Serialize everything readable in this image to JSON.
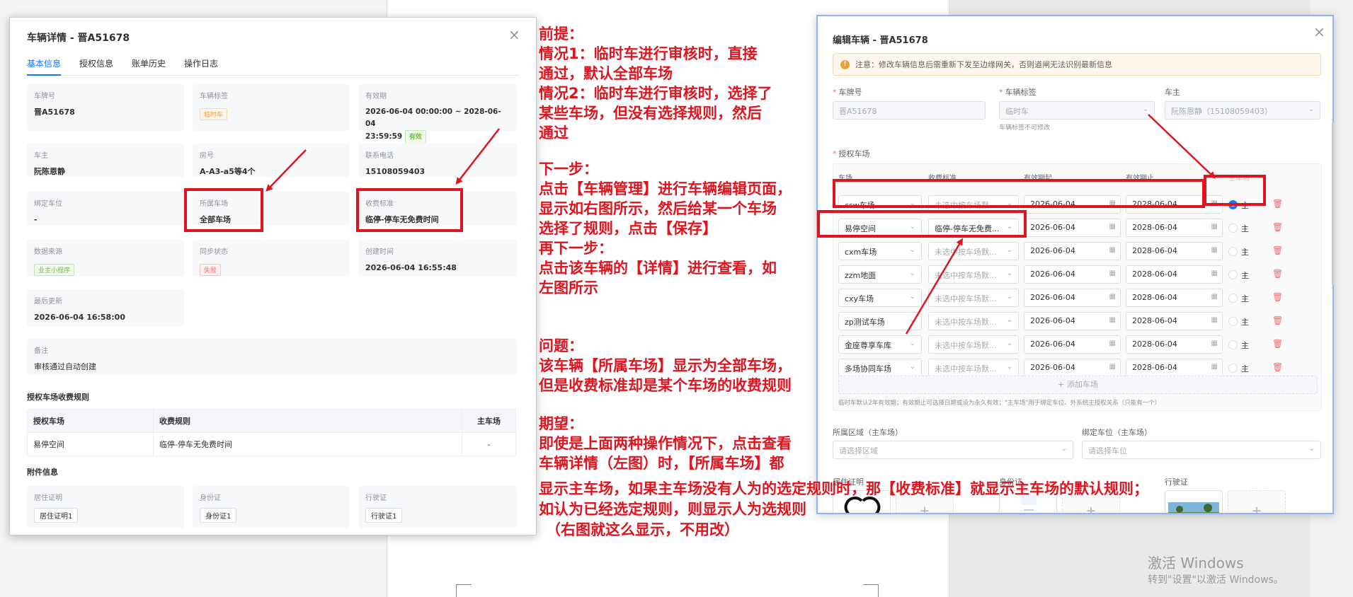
{
  "left_dialog": {
    "title": "车辆详情 - 晋A51678",
    "tabs": [
      "基本信息",
      "授权信息",
      "账单历史",
      "操作日志"
    ],
    "fields": {
      "plate_label": "车牌号",
      "plate_value": "晋A51678",
      "tag_label": "车辆标签",
      "tag_value": "临时车",
      "validity_label": "有效期",
      "validity_value": "2026-06-04 00:00:00 ~ 2028-06-04",
      "validity_value2": "23:59:59",
      "validity_badge": "有效",
      "owner_label": "车主",
      "owner_value": "阮陈恩静",
      "room_label": "房号",
      "room_value": "A-A3-a5等4个",
      "phone_label": "联系电话",
      "phone_value": "15108059403",
      "slot_label": "绑定车位",
      "slot_value": "-",
      "lot_label": "所属车场",
      "lot_value": "全部车场",
      "fee_label": "收费标准",
      "fee_value": "临停-停车无免费时间",
      "source_label": "数据来源",
      "source_value": "业主小程序",
      "sync_label": "同步状态",
      "sync_value": "失败",
      "created_label": "创建时间",
      "created_value": "2026-06-04 16:55:48",
      "updated_label": "最后更新",
      "updated_value": "2026-06-04 16:58:00",
      "remark_label": "备注",
      "remark_value": "审核通过自动创建"
    },
    "rules_section_title": "授权车场收费规则",
    "rules_table": {
      "headers": [
        "授权车场",
        "收费规则",
        "主车场"
      ],
      "rows": [
        [
          "易停空间",
          "临停-停车无免费时间",
          "-"
        ]
      ]
    },
    "attachments_title": "附件信息",
    "attachments": [
      {
        "label": "居住证明",
        "value": "居住证明1"
      },
      {
        "label": "身份证",
        "value": "身份证1"
      },
      {
        "label": "行驶证",
        "value": "行驶证1"
      }
    ]
  },
  "annotation": {
    "lines": [
      "前提：",
      "情况1：临时车进行审核时，直接",
      "通过，默认全部车场",
      "情况2：临时车进行审核时，选择了",
      "某些车场，但没有选择规则，然后",
      "通过",
      "",
      "下一步：",
      "点击【车辆管理】进行车辆编辑页面，",
      "显示如右图所示，然后给某一个车场",
      "选择了规则，点击【保存】",
      "再下一步：",
      "点击该车辆的【详情】进行查看，如",
      "左图所示",
      "",
      "",
      "问题：",
      "该车辆【所属车场】显示为全部车场，",
      "但是收费标准却是某个车场的收费规则",
      "",
      "期望：",
      "即使是上面两种操作情况下，点击查看",
      "车辆详情（左图）时，【所属车场】都"
    ],
    "bottom_lines": [
      "显示主车场，如果主车场没有人为的选定规则时，那【收费标准】就显示主车场的默认规则；",
      "如认为已经选定规则，则显示人为选规则",
      "（右图就这么显示，不用改）"
    ]
  },
  "right_dialog": {
    "title": "编辑车辆 - 晋A51678",
    "alert": "注意：修改车辆信息后需重新下发至边缘网关，否则道闸无法识别最新信息",
    "plate_label": "车牌号",
    "plate_value": "晋A51678",
    "tag_label": "车辆标签",
    "tag_value": "临时车",
    "tag_hint": "车辆标签不可修改",
    "owner_label": "车主",
    "owner_value": "阮陈恩静（15108059403）",
    "lots_label": "授权车场",
    "columns": [
      "车场",
      "收费标准",
      "有效期起",
      "有效期止",
      "主车场"
    ],
    "rows": [
      {
        "lot": "csw车场",
        "fee": "未选中按车场默...",
        "start": "2026-06-04",
        "end": "2028-06-04",
        "main": true
      },
      {
        "lot": "易停空间",
        "fee": "临停-停车无免费...",
        "start": "2026-06-04",
        "end": "2028-06-04",
        "main": false
      },
      {
        "lot": "cxm车场",
        "fee": "未选中按车场默...",
        "start": "2026-06-04",
        "end": "2028-06-04",
        "main": false
      },
      {
        "lot": "zzm地面",
        "fee": "未选中按车场默...",
        "start": "2026-06-04",
        "end": "2028-06-04",
        "main": false
      },
      {
        "lot": "cxy车场",
        "fee": "未选中按车场默...",
        "start": "2026-06-04",
        "end": "2028-06-04",
        "main": false
      },
      {
        "lot": "zp测试车场",
        "fee": "未选中按车场默...",
        "start": "2026-06-04",
        "end": "2028-06-04",
        "main": false
      },
      {
        "lot": "金座尊享车库",
        "fee": "未选中按车场默...",
        "start": "2026-06-04",
        "end": "2028-06-04",
        "main": false
      },
      {
        "lot": "多场协同车场",
        "fee": "未选中按车场默...",
        "start": "2026-06-04",
        "end": "2028-06-04",
        "main": false
      }
    ],
    "main_radio_label": "主",
    "add_lot": "+ 添加车场",
    "lots_hint": "临时车默认2年有效期；有效期止可选择日期或设为永久有效；\"主车场\"用于绑定车位、外系统主授权关系（只能有一个）",
    "area_label": "所属区域（主车场）",
    "area_placeholder": "请选择区域",
    "slot_label": "绑定车位（主车场）",
    "slot_placeholder": "请选择车位",
    "uploads": [
      "居住证明",
      "身份证",
      "行驶证"
    ]
  },
  "windows_watermark": {
    "line1": "激活 Windows",
    "line2": "转到\"设置\"以激活 Windows。"
  },
  "colors": {
    "annotation_red": "#e0141e",
    "primary": "#1677ff"
  },
  "icons": [
    "close-icon",
    "warning-icon",
    "chevron-down-icon",
    "calendar-icon",
    "trash-icon",
    "plus-icon"
  ]
}
